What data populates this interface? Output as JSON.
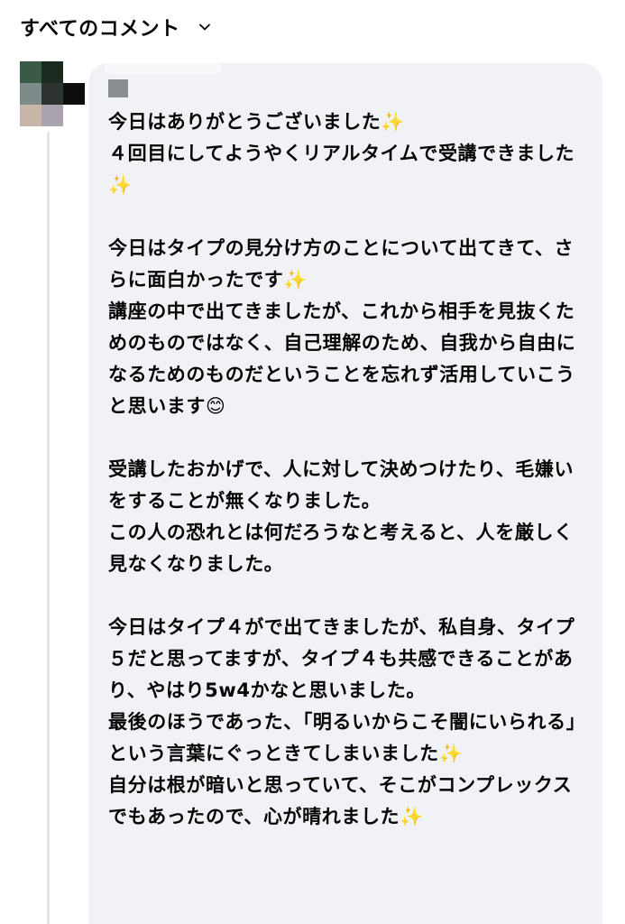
{
  "header": {
    "title": "すべてのコメント",
    "chevron_icon": "chevron-down-icon"
  },
  "comment": {
    "avatar_icon": "pixelated-avatar",
    "author_icon": "redacted-name",
    "text": "今日はありがとうございました✨\n４回目にしてようやくリアルタイムで受講できました✨\n\n今日はタイプの見分け方のことについて出てきて、さらに面白かったです✨\n講座の中で出てきましたが、これから相手を見抜くためのものではなく、自己理解のため、自我から自由になるためのものだということを忘れず活用していこうと思います😊\n\n受講したおかげで、人に対して決めつけたり、毛嫌いをすることが無くなりました。\nこの人の恐れとは何だろうなと考えると、人を厳しく見なくなりました。\n\n今日はタイプ４がで出てきましたが、私自身、タイプ５だと思ってますが、タイプ４も共感できることがあり、やはり5w4かなと思いました。\n最後のほうであった、「明るいからこそ闇にいられる」という言葉にぐっときてしまいました✨\n自分は根が暗いと思っていて、そこがコンプレックスでもあったので、心が晴れました✨"
  },
  "colors": {
    "bubble_bg": "#f0f2f5",
    "text": "#050505",
    "thread_line": "#e4e6eb"
  }
}
